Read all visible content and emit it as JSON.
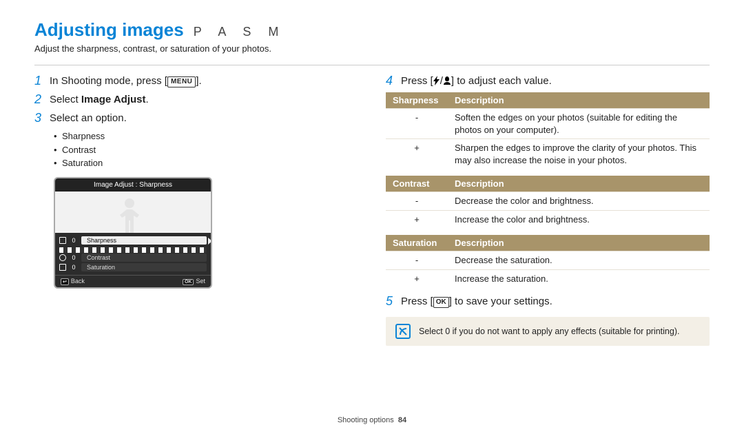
{
  "title": "Adjusting images",
  "modes": "P A S M",
  "intro": "Adjust the sharpness, contrast, or saturation of your photos.",
  "left": {
    "step1_a": "In Shooting mode, press [",
    "step1_btn": "MENU",
    "step1_b": "].",
    "step2_a": "Select ",
    "step2_bold": "Image Adjust",
    "step2_b": ".",
    "step3": "Select an option.",
    "bullets": [
      "Sharpness",
      "Contrast",
      "Saturation"
    ],
    "lcd": {
      "header": "Image Adjust : Sharpness",
      "rows": [
        {
          "val": "0",
          "label": "Sharpness"
        },
        {
          "val": "0",
          "label": "Contrast"
        },
        {
          "val": "0",
          "label": "Saturation"
        }
      ],
      "back_label": "Back",
      "set_label": "Set",
      "back_btn": "↩",
      "set_btn": "OK"
    }
  },
  "right": {
    "step4_a": "Press [",
    "step4_b": "] to adjust each value.",
    "tables": [
      {
        "h1": "Sharpness",
        "h2": "Description",
        "rows": [
          {
            "k": "-",
            "v": "Soften the edges on your photos (suitable for editing the photos on your computer)."
          },
          {
            "k": "+",
            "v": "Sharpen the edges to improve the clarity of your photos. This may also increase the noise in your photos."
          }
        ]
      },
      {
        "h1": "Contrast",
        "h2": "Description",
        "rows": [
          {
            "k": "-",
            "v": "Decrease the color and brightness."
          },
          {
            "k": "+",
            "v": "Increase the color and brightness."
          }
        ]
      },
      {
        "h1": "Saturation",
        "h2": "Description",
        "rows": [
          {
            "k": "-",
            "v": "Decrease the saturation."
          },
          {
            "k": "+",
            "v": "Increase the saturation."
          }
        ]
      }
    ],
    "step5_a": "Press [",
    "step5_ok": "OK",
    "step5_b": "] to save your settings.",
    "note": "Select 0 if you do not want to apply any effects (suitable for printing)."
  },
  "footer_section": "Shooting options",
  "footer_page": "84"
}
